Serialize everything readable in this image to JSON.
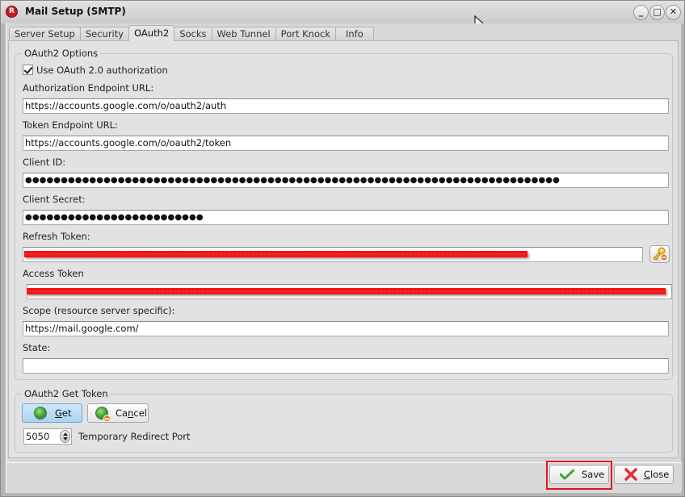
{
  "window": {
    "title": "Mail Setup (SMTP)",
    "app_icon_letter": "R",
    "controls": {
      "minimize": "_",
      "maximize": "□",
      "close": "✕"
    }
  },
  "tabs": [
    {
      "label": "Server Setup",
      "active": false
    },
    {
      "label": "Security",
      "active": false
    },
    {
      "label": "OAuth2",
      "active": true
    },
    {
      "label": "Socks",
      "active": false
    },
    {
      "label": "Web Tunnel",
      "active": false
    },
    {
      "label": "Port Knock",
      "active": false
    },
    {
      "label": "Info",
      "active": false
    }
  ],
  "oauth2_options": {
    "group_title": "OAuth2 Options",
    "use_oauth_label": "Use OAuth 2.0 authorization",
    "use_oauth_checked": true,
    "auth_endpoint_label": "Authorization Endpoint URL:",
    "auth_endpoint_value": "https://accounts.google.com/o/oauth2/auth",
    "token_endpoint_label": "Token Endpoint URL:",
    "token_endpoint_value": "https://accounts.google.com/o/oauth2/token",
    "client_id_label": "Client ID:",
    "client_id_masked": "●●●●●●●●●●●●●●●●●●●●●●●●●●●●●●●●●●●●●●●●●●●●●●●●●●●●●●●●●●●●●●●●●●●●●●●●●●●",
    "client_secret_label": "Client Secret:",
    "client_secret_masked": "●●●●●●●●●●●●●●●●●●●●●●●●●",
    "refresh_token_label": "Refresh Token:",
    "refresh_token_value": "[redacted]",
    "access_token_label": "Access Token",
    "access_token_value": "[redacted]",
    "scope_label": "Scope (resource server specific):",
    "scope_value": "https://mail.google.com/",
    "state_label": "State:",
    "state_value": ""
  },
  "get_token": {
    "group_title": "OAuth2 Get Token",
    "get_button": {
      "prefix": "",
      "accel": "G",
      "rest": "et"
    },
    "cancel_button": {
      "prefix": "Ca",
      "accel": "n",
      "rest": "cel"
    },
    "port_value": "5050",
    "port_label": "Temporary Redirect Port"
  },
  "footer": {
    "save_label": "Save",
    "close_button": {
      "accel": "C",
      "rest": "lose"
    }
  },
  "colors": {
    "redaction": "#ff1010",
    "save_highlight": "#e0141a",
    "get_button_bg": "#b8dcf6"
  }
}
